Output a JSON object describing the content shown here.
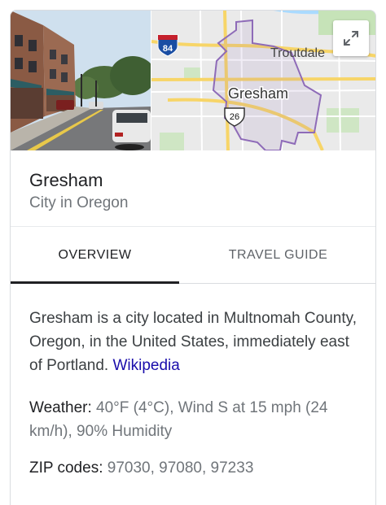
{
  "map": {
    "labels": {
      "interstate": "84",
      "highway": "26",
      "city": "Gresham",
      "nearby": "Troutdale"
    }
  },
  "header": {
    "title": "Gresham",
    "subtitle": "City in Oregon"
  },
  "tabs": [
    {
      "label": "OVERVIEW",
      "active": true
    },
    {
      "label": "TRAVEL GUIDE",
      "active": false
    }
  ],
  "description": {
    "text": "Gresham is a city located in Multnomah County, Oregon, in the United States, immediately east of Portland.",
    "source_link": "Wikipedia"
  },
  "facts": {
    "weather": {
      "label": "Weather:",
      "value": "40°F (4°C), Wind S at 15 mph (24 km/h), 90% Humidity"
    },
    "zip": {
      "label": "ZIP codes:",
      "value": "97030, 97080, 97233"
    }
  },
  "colors": {
    "link": "#1a0dab",
    "secondary_text": "#70757a",
    "city_boundary": "#8e6bb8",
    "tab_indicator": "#202124"
  },
  "icons": [
    "expand-icon"
  ]
}
